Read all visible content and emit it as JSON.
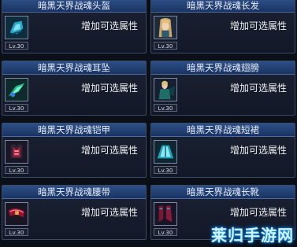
{
  "items": [
    {
      "name": "暗黑天界战魂头盔",
      "desc": "增加可选属性",
      "level": "Lv.30",
      "icon": "helmet-icon"
    },
    {
      "name": "暗黑天界战魂长发",
      "desc": "增加可选属性",
      "level": "Lv.30",
      "icon": "long-hair-icon"
    },
    {
      "name": "暗黑天界战魂耳坠",
      "desc": "增加可选属性",
      "level": "Lv.30",
      "icon": "earring-icon"
    },
    {
      "name": "暗黑天界战魂翅膀",
      "desc": "增加可选属性",
      "level": "Lv.30",
      "icon": "wings-icon"
    },
    {
      "name": "暗黑天界战魂铠甲",
      "desc": "增加可选属性",
      "level": "Lv.30",
      "icon": "armor-icon"
    },
    {
      "name": "暗黑天界战魂短裙",
      "desc": "增加可选属性",
      "level": "Lv.30",
      "icon": "skirt-icon"
    },
    {
      "name": "暗黑天界战魂腰带",
      "desc": "增加可选属性",
      "level": "Lv.30",
      "icon": "belt-icon"
    },
    {
      "name": "暗黑天界战魂长靴",
      "desc": "增加可选属性",
      "level": "Lv.30",
      "icon": "boots-icon"
    }
  ],
  "watermark": "莱归手游网",
  "colors": {
    "title_bar": "#2d4f86",
    "card_bg": "#121827",
    "border": "#3d4a63",
    "text": "#f0f0f0"
  }
}
